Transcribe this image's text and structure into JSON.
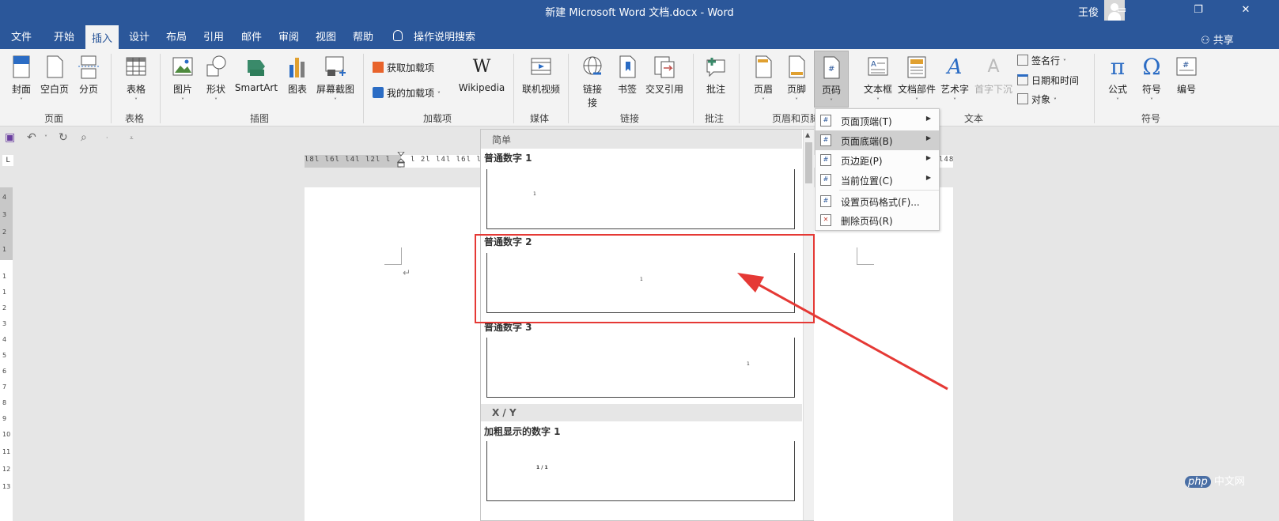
{
  "window": {
    "title": "新建 Microsoft Word 文档.docx - Word",
    "user": "王俊",
    "share": "共享",
    "tell_me": "操作说明搜索"
  },
  "tabs": [
    "文件",
    "开始",
    "插入",
    "设计",
    "布局",
    "引用",
    "邮件",
    "审阅",
    "视图",
    "帮助"
  ],
  "active_tab": "插入",
  "ribbon": {
    "pages": {
      "cover": "封面",
      "blank": "空白页",
      "break": "分页",
      "group": "页面"
    },
    "tables": {
      "table": "表格",
      "group": "表格"
    },
    "illustrations": {
      "picture": "图片",
      "shapes": "形状",
      "smartart": "SmartArt",
      "chart": "图表",
      "screenshot": "屏幕截图",
      "group": "插图"
    },
    "addins": {
      "get": "获取加载项",
      "mine": "我的加载项",
      "wikipedia": "Wikipedia",
      "group": "加载项"
    },
    "media": {
      "video": "联机视频",
      "group": "媒体"
    },
    "links": {
      "link": "链接",
      "link_line2": "接",
      "bookmark": "书签",
      "crossref": "交叉引用",
      "group": "链接"
    },
    "comments": {
      "comment": "批注",
      "group": "批注"
    },
    "headerfooter": {
      "header": "页眉",
      "footer": "页脚",
      "pagenum": "页码",
      "group": "页眉和页脚"
    },
    "text": {
      "textbox": "文本框",
      "quickparts": "文档部件",
      "wordart": "艺术字",
      "dropcap": "首字下沉",
      "signature": "签名行",
      "datetime": "日期和时间",
      "object": "对象",
      "group": "文本"
    },
    "symbols": {
      "equation": "公式",
      "symbol": "符号",
      "number": "编号",
      "group": "符号"
    }
  },
  "gallery": {
    "section1": "简单",
    "items": [
      {
        "title": "普通数字 1",
        "num": "1"
      },
      {
        "title": "普通数字 2",
        "num": "1"
      },
      {
        "title": "普通数字 3",
        "num": "1"
      }
    ],
    "section2": "X / Y",
    "bold_item": {
      "title": "加粗显示的数字 1",
      "num": "1 / 1"
    }
  },
  "menu": {
    "top": "页面顶端(T)",
    "bottom": "页面底端(B)",
    "margin": "页边距(P)",
    "current": "当前位置(C)",
    "format": "设置页码格式(F)...",
    "remove": "删除页码(R)"
  },
  "ruler": {
    "h_left": "l8l l6l l4l l2l l",
    "h_right": "l 2l l4l l6l l8l",
    "h_far": "l48",
    "v": [
      "4",
      "3",
      "2",
      "1",
      "1",
      "1",
      "2",
      "3",
      "4",
      "5",
      "6",
      "7",
      "8",
      "9",
      "10",
      "11",
      "12",
      "13"
    ]
  },
  "watermark": {
    "brand": "php",
    "site": "中文网"
  },
  "colors": {
    "brand": "#2b579a",
    "highlight": "#e53935"
  }
}
